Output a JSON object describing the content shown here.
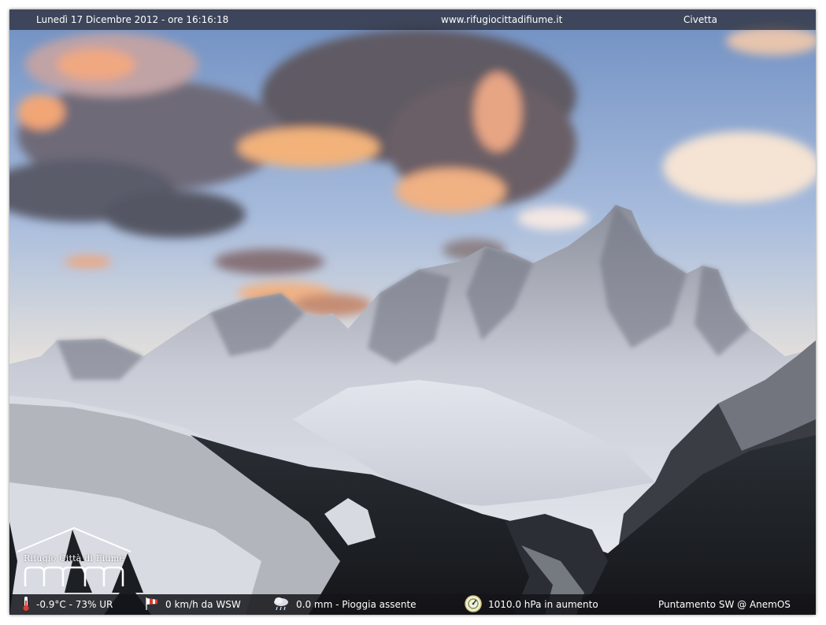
{
  "header": {
    "datetime": "Lunedì 17 Dicembre 2012 - ore 16:16:18",
    "website": "www.rifugiocittadifiume.it",
    "location": "Civetta"
  },
  "footer": {
    "temperature_humidity": "-0.9°C - 73% UR",
    "wind": "0 km/h da WSW",
    "rain": "0.0 mm - Pioggia assente",
    "pressure": "1010.0 hPa in aumento",
    "pointing": "Puntamento SW @ AnemOS"
  },
  "logo": {
    "text": "Rifugio Città di Fiume"
  },
  "icons": [
    "thermometer-icon",
    "windsock-icon",
    "rain-cloud-icon",
    "barometer-icon",
    "refuge-hut-logo"
  ],
  "colors": {
    "sky_top": "#7fa0cf",
    "sky_horizon": "#f0ddc4",
    "cloud_pink": "#f0a577",
    "snow": "#e8ebf2",
    "forest": "#1c2024",
    "bar_bg": "#1a1a20"
  }
}
